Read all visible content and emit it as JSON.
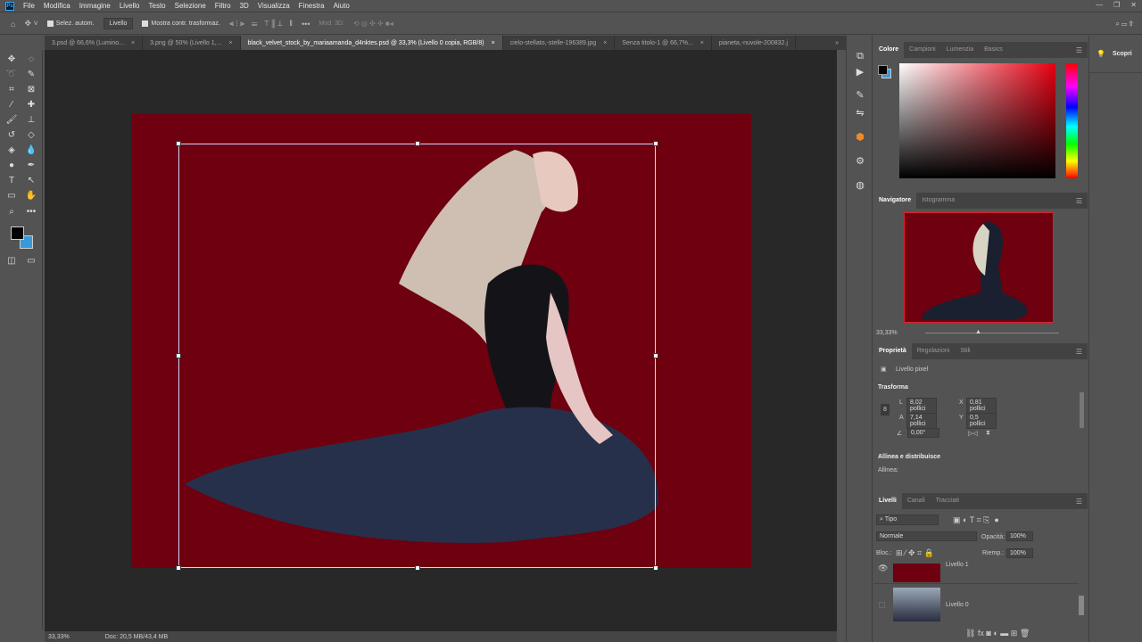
{
  "menu": {
    "logo": "Ps",
    "items": [
      "File",
      "Modifica",
      "Immagine",
      "Livello",
      "Testo",
      "Selezione",
      "Filtro",
      "3D",
      "Visualizza",
      "Finestra",
      "Aiuto"
    ]
  },
  "options": {
    "auto_select_label": "Selez. autom.",
    "auto_select_target": "Livello",
    "show_transform_label": "Mostra contr. trasformaz.",
    "mode3d_label": "Mod. 3D:"
  },
  "tabs": [
    {
      "label": "3.psd @ 66,6% (Lumino..."
    },
    {
      "label": "3.png @ 50% (Livello 1,..."
    },
    {
      "label": "black_velvet_stock_by_mariaamanda_d4nktes.psd @ 33,3% (Livello 0 copia, RGB/8)",
      "active": true
    },
    {
      "label": "cielo-stellato,-stelle-196389.jpg"
    },
    {
      "label": "Senza titolo-1 @ 66,7%..."
    },
    {
      "label": "pianeta,-nuvole-200832.j"
    }
  ],
  "status": {
    "zoom": "33,33%",
    "doc": "Doc: 20,5 MB/43,4 MB"
  },
  "colors": {
    "canvas": "#6e0010",
    "foreground": "#000000",
    "background": "#3a9ad9"
  },
  "color_panel": {
    "tabs": [
      "Colore",
      "Campioni",
      "Lumenzia",
      "Basics"
    ]
  },
  "navigator": {
    "tabs": [
      "Navigatore",
      "Istogramma"
    ],
    "zoom": "33,33%"
  },
  "properties": {
    "tabs": [
      "Proprietà",
      "Regolazioni",
      "Stili"
    ],
    "kind": "Livello pixel",
    "transform_title": "Trasforma",
    "w_label": "L",
    "w": "8,02 pollici",
    "h_label": "A",
    "h": "7,14 pollici",
    "x_label": "X",
    "x": "0,81 pollici",
    "y_label": "Y",
    "y": "0,5 pollici",
    "angle": "0,00°",
    "align_title": "Allinea e distribuisce",
    "align_label": "Allinea:"
  },
  "layers": {
    "tabs": [
      "Livelli",
      "Canali",
      "Tracciati"
    ],
    "filter": "Tipo",
    "blend": "Normale",
    "opacity_label": "Opacità:",
    "opacity": "100%",
    "lock_label": "Bloc.:",
    "fill_label": "Riemp.:",
    "fill": "100%",
    "items": [
      {
        "name": "Livello 1",
        "visible": true
      },
      {
        "name": "Livello 0",
        "visible": false
      }
    ]
  },
  "discover": {
    "label": "Scopri"
  }
}
